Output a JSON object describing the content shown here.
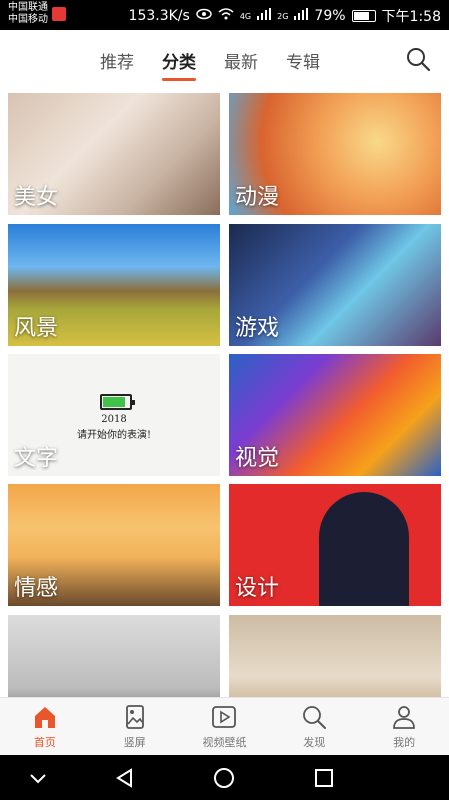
{
  "status_bar": {
    "carrier_line1": "中国联通",
    "carrier_line2": "中国移动",
    "speed": "153.3K/s",
    "net1": "4G",
    "net2": "2G",
    "battery": "79%",
    "time": "下午1:58"
  },
  "top_tabs": [
    {
      "label": "推荐",
      "active": false
    },
    {
      "label": "分类",
      "active": true
    },
    {
      "label": "最新",
      "active": false
    },
    {
      "label": "专辑",
      "active": false
    }
  ],
  "categories": [
    {
      "label": "美女"
    },
    {
      "label": "动漫"
    },
    {
      "label": "风景"
    },
    {
      "label": "游戏"
    },
    {
      "label": "文字",
      "art_year": "2018",
      "art_text": "请开始你的表演!"
    },
    {
      "label": "视觉"
    },
    {
      "label": "情感"
    },
    {
      "label": "设计"
    },
    {
      "label": ""
    },
    {
      "label": ""
    }
  ],
  "bottom_nav": [
    {
      "label": "首页",
      "icon": "home-icon",
      "active": true
    },
    {
      "label": "竖屏",
      "icon": "portrait-image-icon",
      "active": false
    },
    {
      "label": "视频壁纸",
      "icon": "video-play-icon",
      "active": false
    },
    {
      "label": "发现",
      "icon": "search-icon",
      "active": false
    },
    {
      "label": "我的",
      "icon": "user-icon",
      "active": false
    }
  ],
  "colors": {
    "accent": "#e8562a",
    "status_bg": "#000000",
    "nav_bg": "#f7f7f7"
  }
}
